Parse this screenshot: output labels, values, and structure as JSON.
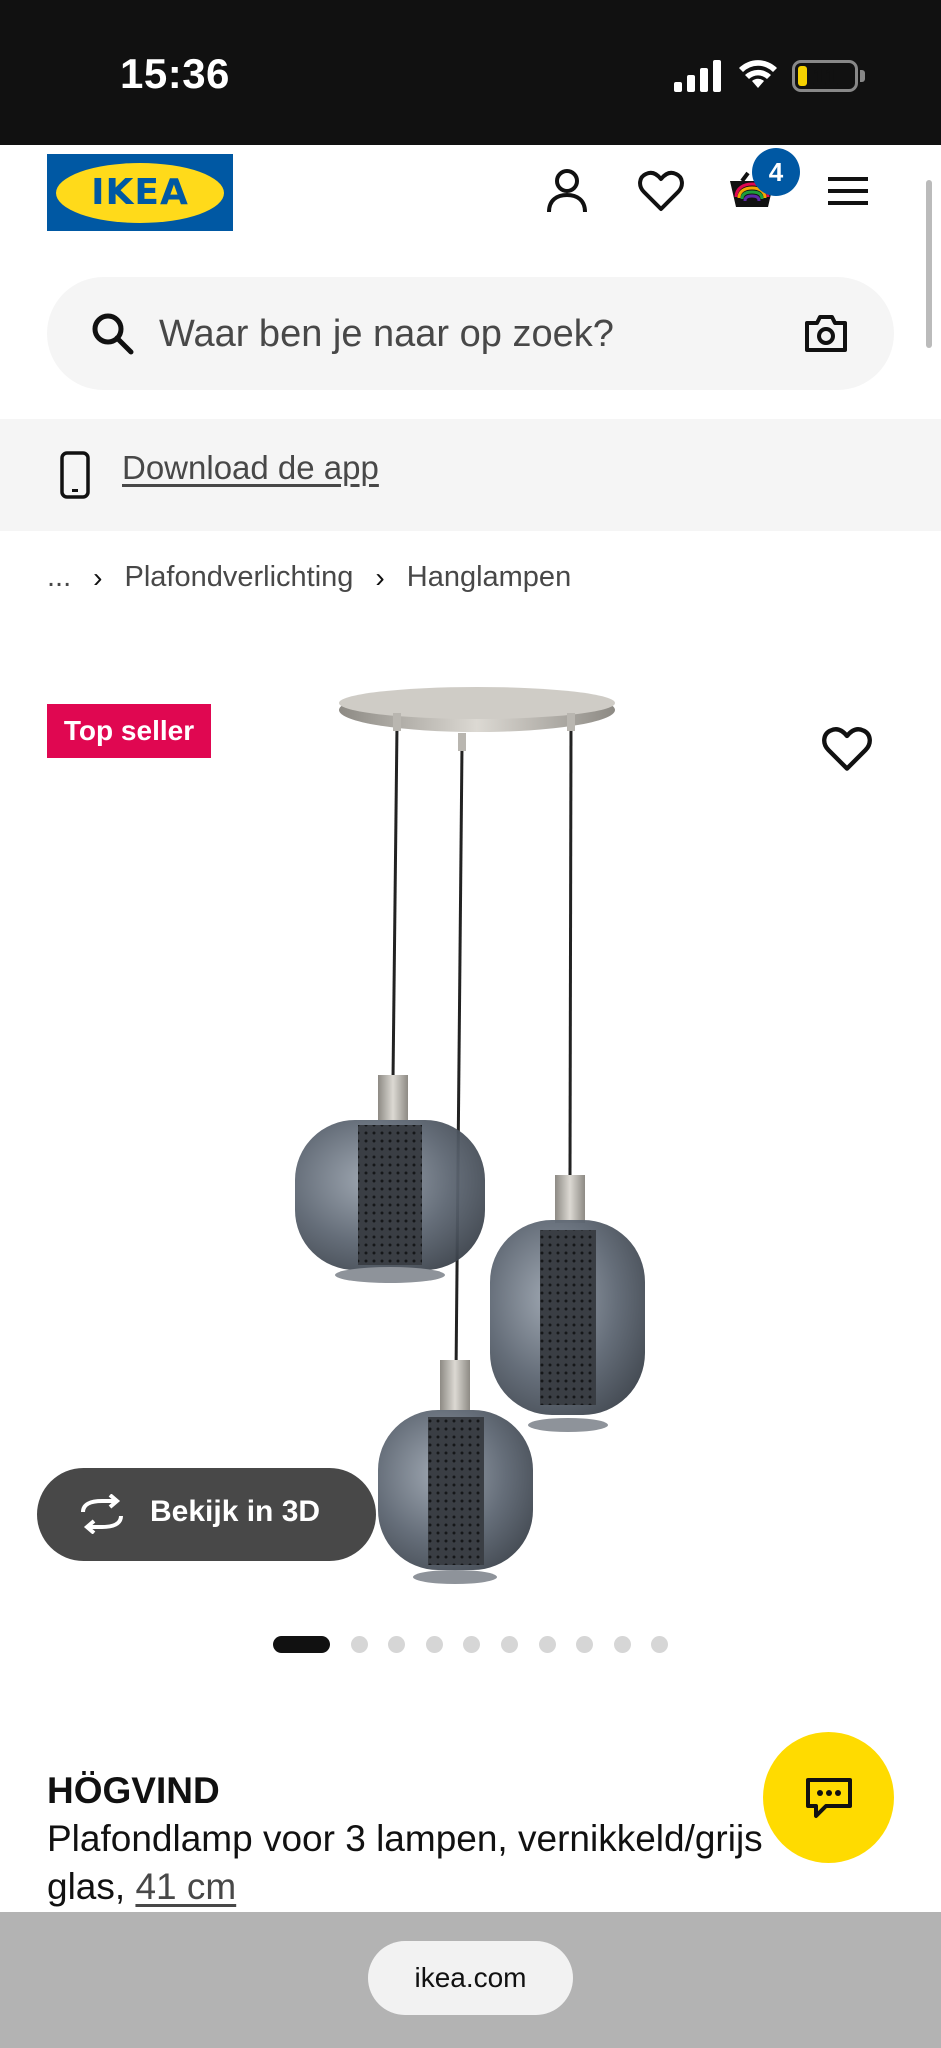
{
  "status_bar": {
    "time": "15:36",
    "battery": "11"
  },
  "header": {
    "logo_text": "IKEA",
    "cart_count": "4"
  },
  "search": {
    "placeholder": "Waar ben je naar op zoek?"
  },
  "app_banner": {
    "link": "Download de app"
  },
  "breadcrumb": {
    "ellipsis": "...",
    "items": [
      "Plafondverlichting",
      "Hanglampen"
    ]
  },
  "product": {
    "badge": "Top seller",
    "view_3d": "Bekijk in 3D",
    "image_count": 10,
    "active_image": 1,
    "name": "HÖGVIND",
    "description": "Plafondlamp voor 3 lampen, vernikkeld/grijs glas,",
    "size": "41 cm"
  },
  "browser": {
    "url": "ikea.com"
  },
  "colors": {
    "ikea_blue": "#0058a3",
    "ikea_yellow": "#ffda1a",
    "badge_red": "#e00751",
    "chat_yellow": "#ffdb00"
  }
}
